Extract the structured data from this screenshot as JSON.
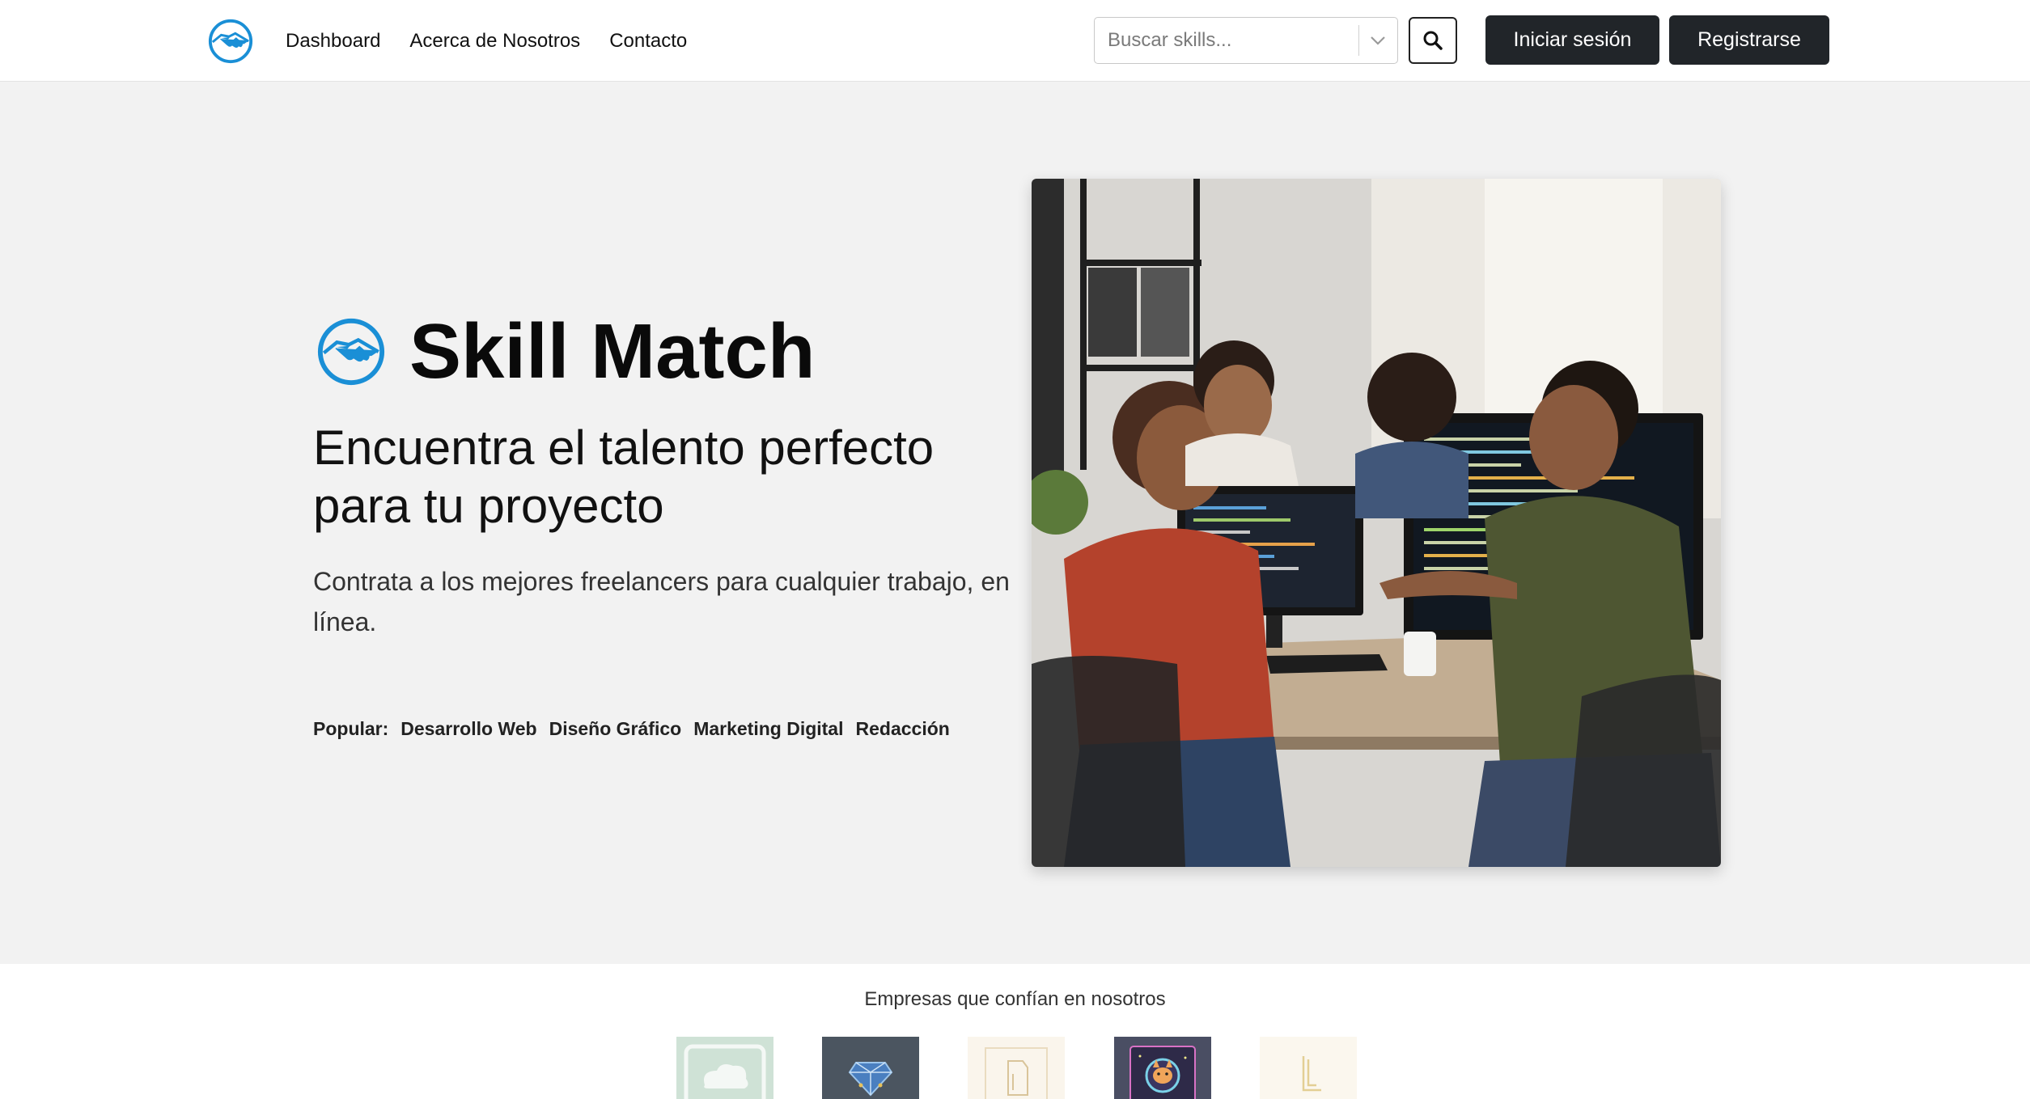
{
  "nav": {
    "links": [
      "Dashboard",
      "Acerca de Nosotros",
      "Contacto"
    ],
    "search_placeholder": "Buscar skills...",
    "login_label": "Iniciar sesión",
    "register_label": "Registrarse"
  },
  "hero": {
    "brand": "Skill Match",
    "heading": "Encuentra el talento perfecto para tu proyecto",
    "subheading": "Contrata a los mejores freelancers para cualquier trabajo, en línea.",
    "popular_label": "Popular:",
    "popular_tags": [
      "Desarrollo Web",
      "Diseño Gráfico",
      "Marketing Digital",
      "Redacción"
    ]
  },
  "partners": {
    "title": "Empresas que confían en nosotros",
    "logos": [
      "cloud-logo",
      "diamond-circuit-logo",
      "document-logo",
      "cat-astronaut-logo",
      "letter-l-logo"
    ]
  },
  "colors": {
    "accent": "#1a8fd6",
    "button_dark": "#212529",
    "hero_bg": "#f2f2f2"
  },
  "icons": {
    "brand": "handshake-circle-icon",
    "search": "search-icon",
    "dropdown": "chevron-down-icon"
  }
}
